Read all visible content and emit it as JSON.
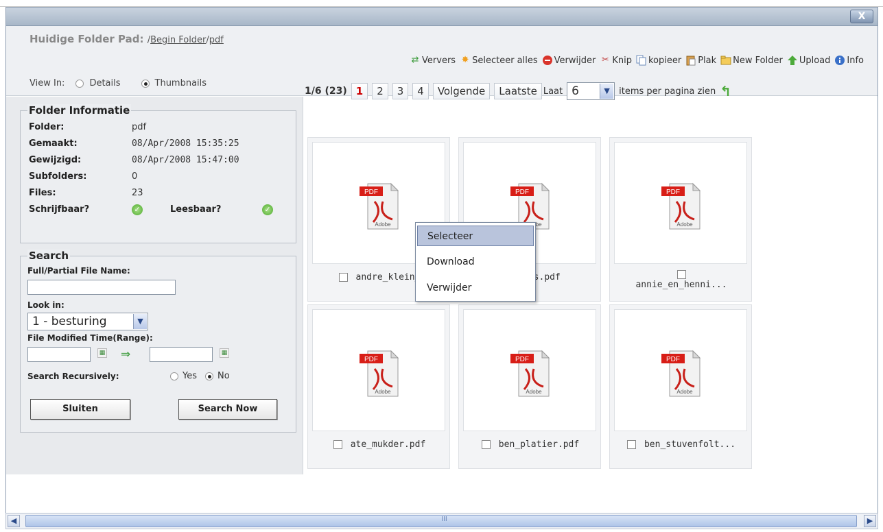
{
  "window": {
    "close_label": "X"
  },
  "path": {
    "label": "Huidige Folder Pad:",
    "sep1": "/",
    "crumb_root": "Begin Folder",
    "sep2": "/",
    "crumb_current": "pdf"
  },
  "toolbar": {
    "items": [
      {
        "label": "Ververs",
        "icon": "refresh-icon"
      },
      {
        "label": "Selecteer alles",
        "icon": "select-all-icon"
      },
      {
        "label": "Verwijder",
        "icon": "delete-icon"
      },
      {
        "label": "Knip",
        "icon": "scissors-icon"
      },
      {
        "label": "kopieer",
        "icon": "copy-icon"
      },
      {
        "label": "Plak",
        "icon": "paste-icon"
      },
      {
        "label": "New Folder",
        "icon": "new-folder-icon"
      },
      {
        "label": "Upload",
        "icon": "upload-icon"
      },
      {
        "label": "Info",
        "icon": "info-icon"
      }
    ]
  },
  "view": {
    "label": "View In:",
    "details": "Details",
    "thumbnails": "Thumbnails",
    "selected": "Thumbnails"
  },
  "folder_info": {
    "title": "Folder Informatie",
    "folder_label": "Folder:",
    "folder_value": "pdf",
    "created_label": "Gemaakt:",
    "created_value": "08/Apr/2008 15:35:25",
    "modified_label": "Gewijzigd:",
    "modified_value": "08/Apr/2008 15:47:00",
    "subfolders_label": "Subfolders:",
    "subfolders_value": "0",
    "files_label": "Files:",
    "files_value": "23",
    "writable_label": "Schrijfbaar?",
    "readable_label": "Leesbaar?"
  },
  "search": {
    "title": "Search",
    "name_label": "Full/Partial File Name:",
    "name_value": "",
    "lookin_label": "Look in:",
    "lookin_value": "1 - besturing",
    "modified_label": "File Modified Time(Range):",
    "recursive_label": "Search Recursively:",
    "yes": "Yes",
    "no": "No",
    "recursive_selected": "No",
    "close_button": "Sluiten",
    "search_button": "Search Now"
  },
  "pager": {
    "summary": "1/6 (23)",
    "pages": [
      "1",
      "2",
      "3",
      "4"
    ],
    "current": "1",
    "next": "Volgende",
    "last": "Laatste",
    "show_prefix": "Laat",
    "per_page": "6",
    "show_suffix": "items per pagina zien"
  },
  "files": [
    {
      "name": "andre_klein_"
    },
    {
      "name": "mels.pdf"
    },
    {
      "name": "annie_en_henni..."
    },
    {
      "name": "ate_mukder.pdf"
    },
    {
      "name": "ben_platier.pdf"
    },
    {
      "name": "ben_stuvenfolt..."
    }
  ],
  "pdf_icon": {
    "badge": "PDF",
    "brand": "Adobe"
  },
  "context_menu": {
    "items": [
      "Selecteer",
      "Download",
      "Verwijder"
    ],
    "highlighted": "Selecteer"
  },
  "scrollbar": {
    "grip": "III"
  }
}
